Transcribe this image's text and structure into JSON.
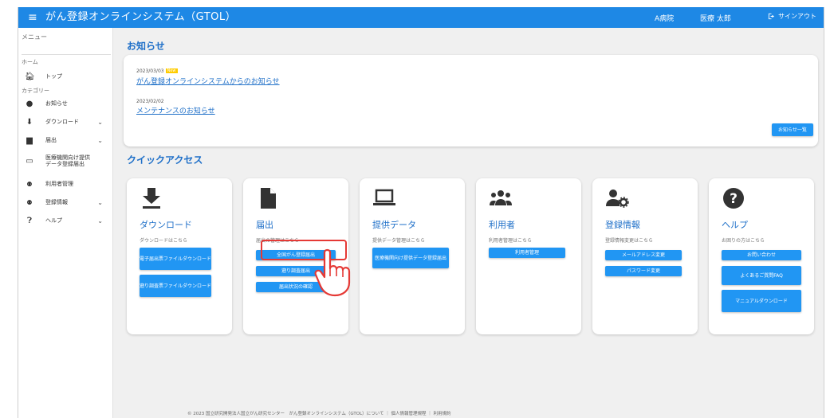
{
  "header": {
    "app_title": "がん登録オンラインシステム（GTOL）",
    "hospital": "A病院",
    "user": "医療 太郎",
    "signout_label": "サインアウト"
  },
  "sidebar": {
    "menu_label": "メニュー",
    "home_label": "ホーム",
    "category_label": "カテゴリー",
    "items": [
      {
        "label": "トップ",
        "icon": "home-icon"
      },
      {
        "label": "お知らせ",
        "icon": "info-icon"
      },
      {
        "label": "ダウンロード",
        "icon": "download-icon"
      },
      {
        "label": "届出",
        "icon": "file-icon"
      },
      {
        "label": "医療機関向け提供データ登録届出",
        "icon": "laptop-icon"
      },
      {
        "label": "利用者管理",
        "icon": "users-icon"
      },
      {
        "label": "登録情報",
        "icon": "user-cog-icon"
      },
      {
        "label": "ヘルプ",
        "icon": "help-icon"
      }
    ]
  },
  "news": {
    "section_title": "お知らせ",
    "items": [
      {
        "date": "2023/03/03",
        "badge": "New",
        "title": "がん登録オンラインシステムからのお知らせ"
      },
      {
        "date": "2023/02/02",
        "badge": "",
        "title": "メンテナンスのお知らせ"
      }
    ],
    "list_button": "お知らせ一覧"
  },
  "quick_access": {
    "section_title": "クイックアクセス",
    "cards": [
      {
        "title": "ダウンロード",
        "desc": "ダウンロードはこちら",
        "icon": "download-icon",
        "buttons": [
          "電子届出票ファイルダウンロード",
          "遡り調査票ファイルダウンロード"
        ]
      },
      {
        "title": "届出",
        "desc": "届出の管理はこちら",
        "icon": "file-icon",
        "buttons": [
          "全国がん登録届出",
          "遡り調査届出",
          "届出状況の確認"
        ]
      },
      {
        "title": "提供データ",
        "desc": "提供データ管理はこちら",
        "icon": "laptop-icon",
        "buttons": [
          "医療機関向け提供データ登録届出"
        ]
      },
      {
        "title": "利用者",
        "desc": "利用者管理はこちら",
        "icon": "users-icon",
        "buttons": [
          "利用者管理"
        ]
      },
      {
        "title": "登録情報",
        "desc": "登録情報変更はこちら",
        "icon": "user-cog-icon",
        "buttons": [
          "メールアドレス変更",
          "パスワード変更"
        ]
      },
      {
        "title": "ヘルプ",
        "desc": "お困りの方はこちら",
        "icon": "help-icon",
        "buttons": [
          "お問い合わせ",
          "よくあるご質問FAQ",
          "マニュアルダウンロード"
        ]
      }
    ]
  },
  "footer": {
    "text": "© 2023 国立研究開発法人国立がん研究センター　がん登録オンラインシステム（GTOL）について ｜ 個人情報管理規程 ｜ 利用規約"
  },
  "colors": {
    "primary": "#1e88e5",
    "button": "#2196f3",
    "highlight": "#e53935",
    "badge": "#ffcc00"
  }
}
